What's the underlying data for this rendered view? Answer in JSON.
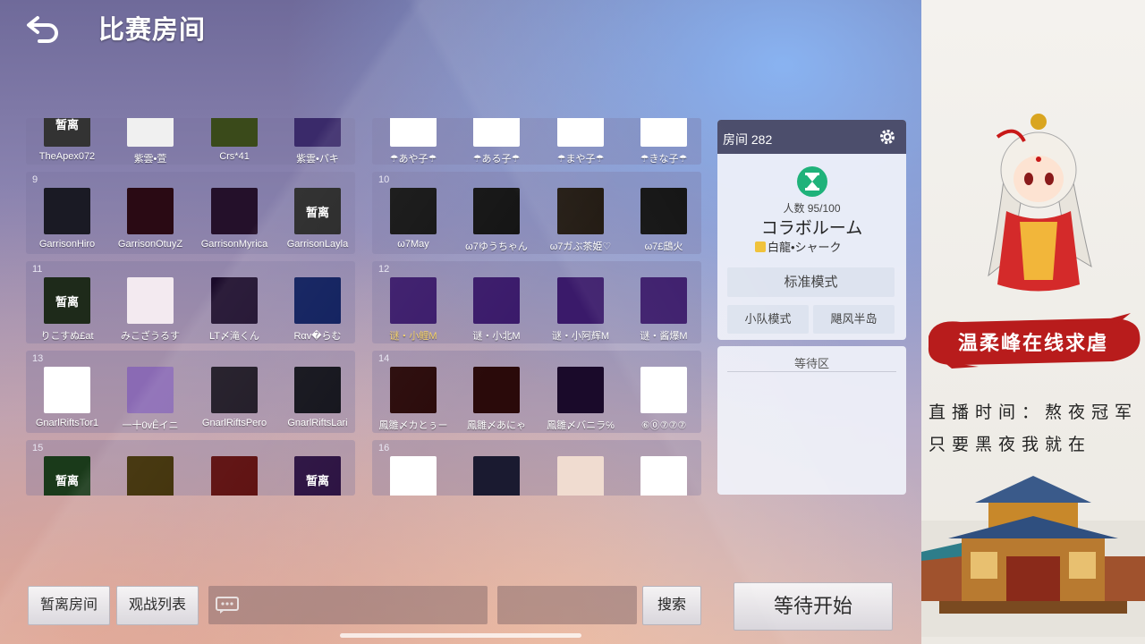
{
  "header": {
    "title": "比赛房间"
  },
  "teams": [
    {
      "id": "t1",
      "number": "",
      "players": [
        {
          "name": "TheApex072",
          "avatar": "暂离",
          "bg": "#333"
        },
        {
          "name": "紫雲•萱",
          "avatar": "",
          "bg": "#f0f0f0"
        },
        {
          "name": "Crs*41",
          "avatar": "",
          "bg": "#3a4a1a"
        },
        {
          "name": "紫雲•パキ",
          "avatar": "",
          "bg": "#3a2a6a"
        }
      ]
    },
    {
      "id": "t2",
      "number": "",
      "players": [
        {
          "name": "☂あや子☂",
          "avatar": "",
          "bg": "#fff"
        },
        {
          "name": "☂ある子☂",
          "avatar": "",
          "bg": "#fff"
        },
        {
          "name": "☂まや子☂",
          "avatar": "",
          "bg": "#fff"
        },
        {
          "name": "☂きな子☂",
          "avatar": "",
          "bg": "#fff"
        }
      ]
    },
    {
      "id": "t9",
      "number": "9",
      "players": [
        {
          "name": "GarrisonHiro",
          "avatar": "",
          "bg": "#1a1a24"
        },
        {
          "name": "GarrisonOtuyZ",
          "avatar": "",
          "bg": "#2a0a14"
        },
        {
          "name": "GarrisonMyrica",
          "avatar": "",
          "bg": "#24102a"
        },
        {
          "name": "GarrisonLayla",
          "avatar": "暂离",
          "bg": "#222"
        }
      ]
    },
    {
      "id": "t10",
      "number": "10",
      "players": [
        {
          "name": "ω7May",
          "avatar": "",
          "bg": "#111"
        },
        {
          "name": "ω7ゆうちゃん",
          "avatar": "",
          "bg": "#111"
        },
        {
          "name": "ω7ガぶ茶姫♡",
          "avatar": "",
          "bg": "#1a120a"
        },
        {
          "name": "ω7£鴟火",
          "avatar": "",
          "bg": "#111"
        }
      ]
    },
    {
      "id": "t11",
      "number": "11",
      "players": [
        {
          "name": "りこすぬ£at",
          "avatar": "暂离",
          "bg": "#1e2a1a"
        },
        {
          "name": "みこざうるす",
          "avatar": "",
          "bg": "#f3eaf0"
        },
        {
          "name": "LT〆滝くん",
          "avatar": "",
          "bg": "#1a0a2a"
        },
        {
          "name": "Rαv�らむ",
          "avatar": "",
          "bg": "#0a1a5a"
        }
      ]
    },
    {
      "id": "t12",
      "number": "12",
      "players": [
        {
          "name": "谜・小鲤M",
          "avatar": "",
          "bg": "#3a1a6a",
          "gold": true
        },
        {
          "name": "谜・小北M",
          "avatar": "",
          "bg": "#3a1a6a"
        },
        {
          "name": "谜・小阿辉M",
          "avatar": "",
          "bg": "#3a1a6a"
        },
        {
          "name": "谜・酱爆M",
          "avatar": "",
          "bg": "#3a1a6a"
        }
      ]
    },
    {
      "id": "t13",
      "number": "13",
      "players": [
        {
          "name": "GnarlRiftsTor1",
          "avatar": "",
          "bg": "#fff"
        },
        {
          "name": "一十0vÊイニ",
          "avatar": "",
          "bg": "#8a6ab4"
        },
        {
          "name": "GnarlRiftsPero",
          "avatar": "",
          "bg": "#1a1420"
        },
        {
          "name": "GnarlRiftsLari",
          "avatar": "",
          "bg": "#101018"
        }
      ]
    },
    {
      "id": "t14",
      "number": "14",
      "players": [
        {
          "name": "鳳雛〆カとぅー",
          "avatar": "",
          "bg": "#2a0a0a"
        },
        {
          "name": "鳳雛〆あにゃ",
          "avatar": "",
          "bg": "#2a0a0a"
        },
        {
          "name": "鳳雛〆バニラ℅",
          "avatar": "",
          "bg": "#1a0a2a"
        },
        {
          "name": "⑥⓪⑦⑦⑦",
          "avatar": "",
          "bg": "#fff"
        }
      ]
    },
    {
      "id": "t15",
      "number": "15",
      "players": [
        {
          "name": "",
          "avatar": "暂离",
          "bg": "#1a3a1a"
        },
        {
          "name": "",
          "avatar": "",
          "bg": "#3a2a00"
        },
        {
          "name": "",
          "avatar": "",
          "bg": "#5a0a0a"
        },
        {
          "name": "",
          "avatar": "暂离",
          "bg": "#2a1040"
        }
      ]
    },
    {
      "id": "t16",
      "number": "16",
      "players": [
        {
          "name": "",
          "avatar": "",
          "bg": "#fff"
        },
        {
          "name": "",
          "avatar": "",
          "bg": "#1a1a30"
        },
        {
          "name": "",
          "avatar": "",
          "bg": "#f0dcd0"
        },
        {
          "name": "",
          "avatar": "",
          "bg": "#fff"
        }
      ]
    }
  ],
  "room": {
    "label": "房间 282",
    "count_label": "人数 95/100",
    "name": "コラボルーム",
    "host": "白龍•シャーク",
    "mode_standard": "标准模式",
    "mode_team": "小队模式",
    "map": "飓风半岛",
    "waiting_area": "等待区"
  },
  "footer": {
    "away_room": "暂离房间",
    "spectate_list": "观战列表",
    "search_button": "搜索",
    "start_wait": "等待开始"
  },
  "stream": {
    "banner": "温柔峰在线求虐",
    "line1": "直播时间：熬夜冠军",
    "line2": "只要黑夜我就在"
  },
  "colors": {
    "accent_green": "#1fb27a",
    "header_dark": "#4c4e6c",
    "banner_red": "#b81c1c"
  }
}
